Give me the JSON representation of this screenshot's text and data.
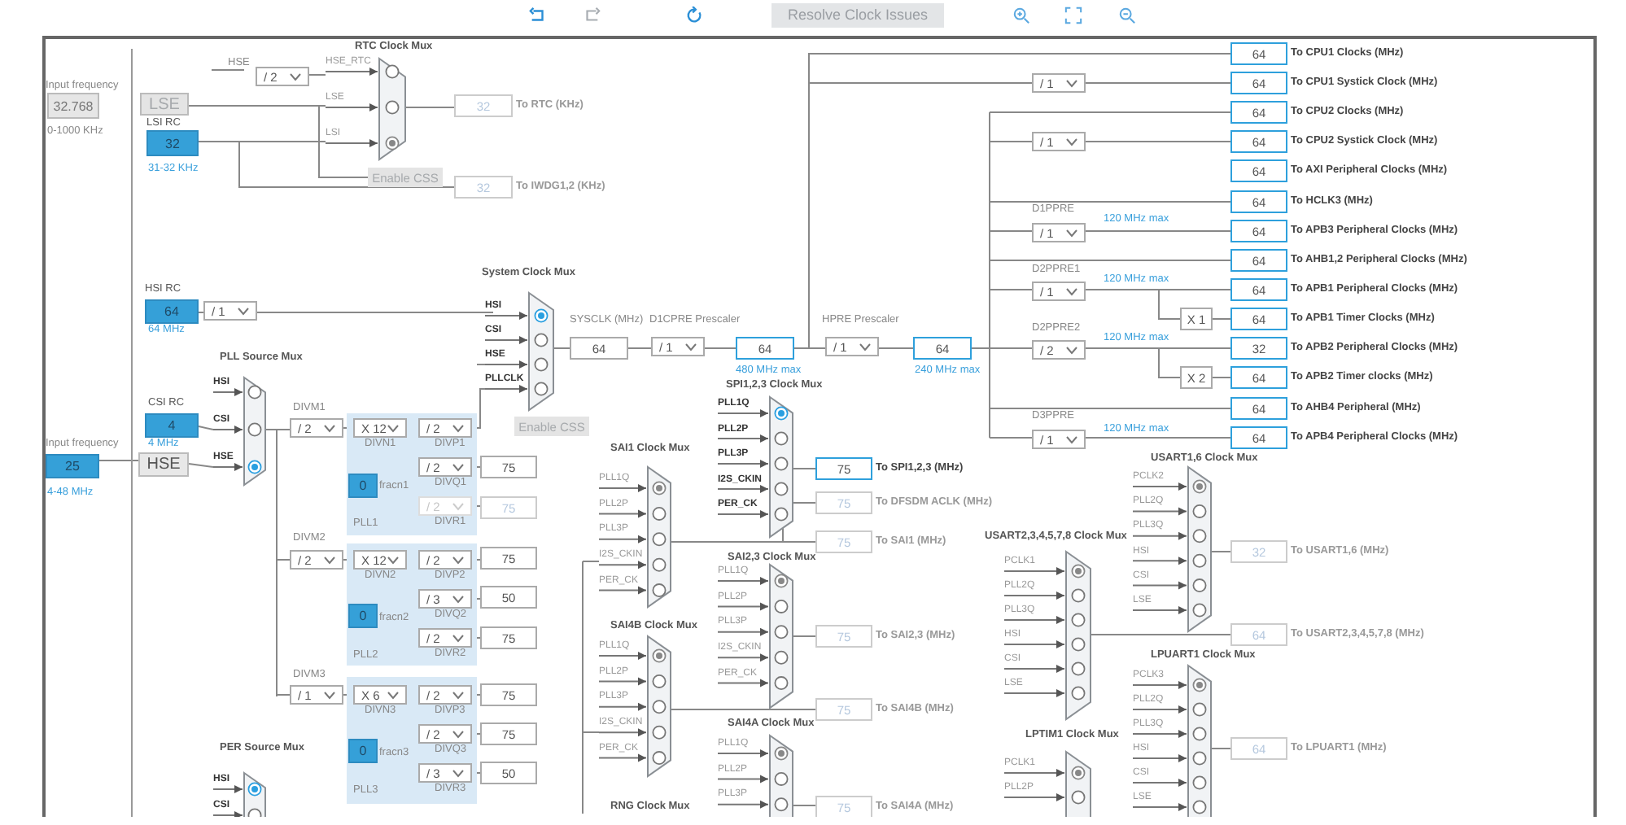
{
  "toolbar": {
    "resolve_button": {
      "label": "Resolve Clock Issues",
      "disabled": true
    }
  },
  "labels": [
    {
      "text": "Input frequency",
      "kind": "caption"
    },
    {
      "text": "0-1000 KHz",
      "kind": "caption"
    },
    {
      "text": "LSI RC",
      "kind": "name"
    },
    {
      "text": "31-32 KHz",
      "kind": "hint"
    },
    {
      "text": "HSE",
      "kind": "caption"
    },
    {
      "text": "HSI RC",
      "kind": "name"
    },
    {
      "text": "64 MHz",
      "kind": "hint"
    },
    {
      "text": "SYSCLK (MHz)",
      "kind": "caption"
    },
    {
      "text": "D1CPRE Prescaler",
      "kind": "caption"
    },
    {
      "text": "480 MHz max",
      "kind": "hint"
    },
    {
      "text": "HPRE Prescaler",
      "kind": "caption"
    },
    {
      "text": "240 MHz max",
      "kind": "hint"
    },
    {
      "text": "D1PPRE",
      "kind": "caption"
    },
    {
      "text": "120 MHz max",
      "kind": "hint"
    },
    {
      "text": "D2PPRE1",
      "kind": "caption"
    },
    {
      "text": "120 MHz max",
      "kind": "hint"
    },
    {
      "text": "D2PPRE2",
      "kind": "caption"
    },
    {
      "text": "120 MHz max",
      "kind": "hint"
    },
    {
      "text": "D3PPRE",
      "kind": "caption"
    },
    {
      "text": "120 MHz max",
      "kind": "hint"
    },
    {
      "text": "CSI RC",
      "kind": "name"
    },
    {
      "text": "Input frequency",
      "kind": "caption"
    },
    {
      "text": "4 MHz",
      "kind": "hint"
    },
    {
      "text": "4-48 MHz",
      "kind": "hint"
    },
    {
      "text": "DIVM1",
      "kind": "caption"
    },
    {
      "text": "DIVN1",
      "kind": "caption"
    },
    {
      "text": "DIVP1",
      "kind": "caption"
    },
    {
      "text": "DIVQ1",
      "kind": "caption"
    },
    {
      "text": "fracn1",
      "kind": "caption"
    },
    {
      "text": "DIVR1",
      "kind": "caption"
    },
    {
      "text": "PLL1",
      "kind": "caption"
    },
    {
      "text": "DIVM2",
      "kind": "caption"
    },
    {
      "text": "DIVN2",
      "kind": "caption"
    },
    {
      "text": "DIVP2",
      "kind": "caption"
    },
    {
      "text": "DIVQ2",
      "kind": "caption"
    },
    {
      "text": "fracn2",
      "kind": "caption"
    },
    {
      "text": "DIVR2",
      "kind": "caption"
    },
    {
      "text": "PLL2",
      "kind": "caption"
    },
    {
      "text": "DIVM3",
      "kind": "caption"
    },
    {
      "text": "DIVN3",
      "kind": "caption"
    },
    {
      "text": "DIVP3",
      "kind": "caption"
    },
    {
      "text": "DIVQ3",
      "kind": "caption"
    },
    {
      "text": "fracn3",
      "kind": "caption"
    },
    {
      "text": "DIVR3",
      "kind": "caption"
    },
    {
      "text": "PLL3",
      "kind": "caption"
    },
    {
      "text": "RNG Clock Mux",
      "kind": "title"
    }
  ],
  "inputs": [
    {
      "value": "32.768",
      "disabled": true
    },
    {
      "value": "32",
      "disabled": false
    },
    {
      "value": "64",
      "disabled": false
    },
    {
      "value": "4",
      "disabled": false
    },
    {
      "value": "25",
      "disabled": false
    },
    {
      "value": "0",
      "disabled": false
    },
    {
      "value": "0",
      "disabled": false
    },
    {
      "value": "0",
      "disabled": false
    }
  ],
  "buttons": [
    {
      "label": "LSE",
      "kind": "oscillator",
      "disabled": true
    },
    {
      "label": "HSE",
      "kind": "oscillator",
      "disabled": false
    },
    {
      "label": "Enable CSS",
      "kind": "css",
      "disabled": true
    },
    {
      "label": "Enable CSS",
      "kind": "css",
      "disabled": true
    }
  ],
  "dropdowns": [
    {
      "value": "/ 2",
      "disabled": false
    },
    {
      "value": "/ 1",
      "disabled": false
    },
    {
      "value": "/ 1",
      "disabled": false
    },
    {
      "value": "/ 1",
      "disabled": false
    },
    {
      "value": "/ 1",
      "disabled": false
    },
    {
      "value": "/ 1",
      "disabled": false
    },
    {
      "value": "/ 1",
      "disabled": false
    },
    {
      "value": "/ 1",
      "disabled": false
    },
    {
      "value": "/ 2",
      "disabled": false
    },
    {
      "value": "/ 1",
      "disabled": false
    },
    {
      "value": "/ 2",
      "disabled": false
    },
    {
      "value": "X 12",
      "disabled": false
    },
    {
      "value": "/ 2",
      "disabled": false
    },
    {
      "value": "/ 2",
      "disabled": false
    },
    {
      "value": "/ 2",
      "disabled": true
    },
    {
      "value": "/ 2",
      "disabled": false
    },
    {
      "value": "X 12",
      "disabled": false
    },
    {
      "value": "/ 2",
      "disabled": false
    },
    {
      "value": "/ 3",
      "disabled": false
    },
    {
      "value": "/ 2",
      "disabled": false
    },
    {
      "value": "/ 1",
      "disabled": false
    },
    {
      "value": "X 6",
      "disabled": false
    },
    {
      "value": "/ 2",
      "disabled": false
    },
    {
      "value": "/ 2",
      "disabled": false
    },
    {
      "value": "/ 3",
      "disabled": false
    }
  ],
  "outputs": [
    {
      "value": "32",
      "label": "To RTC (KHz)",
      "highlighted": false,
      "disabled": true
    },
    {
      "value": "32",
      "label": "To IWDG1,2 (KHz)",
      "highlighted": false,
      "disabled": true
    },
    {
      "value": "64",
      "highlighted": false,
      "disabled": false
    },
    {
      "value": "64",
      "highlighted": true,
      "disabled": false
    },
    {
      "value": "64",
      "highlighted": true,
      "disabled": false
    },
    {
      "value": "64",
      "label": "To CPU1 Clocks (MHz)",
      "highlighted": true,
      "disabled": false
    },
    {
      "value": "64",
      "label": "To CPU1 Systick Clock (MHz)",
      "highlighted": true,
      "disabled": false
    },
    {
      "value": "64",
      "label": "To CPU2 Clocks (MHz)",
      "highlighted": true,
      "disabled": false
    },
    {
      "value": "64",
      "label": "To CPU2 Systick Clock (MHz)",
      "highlighted": true,
      "disabled": false
    },
    {
      "value": "64",
      "label": "To AXI Peripheral Clocks (MHz)",
      "highlighted": true,
      "disabled": false
    },
    {
      "value": "64",
      "label": "To HCLK3 (MHz)",
      "highlighted": true,
      "disabled": false
    },
    {
      "value": "64",
      "label": "To APB3 Peripheral Clocks (MHz)",
      "highlighted": true,
      "disabled": false
    },
    {
      "value": "64",
      "label": "To AHB1,2 Peripheral Clocks (MHz)",
      "highlighted": true,
      "disabled": false
    },
    {
      "value": "64",
      "label": "To APB1 Peripheral Clocks (MHz)",
      "highlighted": true,
      "disabled": false
    },
    {
      "value": "64",
      "label": "To APB1 Timer Clocks (MHz)",
      "highlighted": true,
      "disabled": false
    },
    {
      "value": "32",
      "label": "To APB2 Peripheral Clocks (MHz)",
      "highlighted": true,
      "disabled": false
    },
    {
      "value": "64",
      "label": "To APB2 Timer clocks (MHz)",
      "highlighted": true,
      "disabled": false
    },
    {
      "value": "64",
      "label": "To AHB4 Peripheral (MHz)",
      "highlighted": true,
      "disabled": false
    },
    {
      "value": "64",
      "label": "To APB4 Peripheral Clocks (MHz)",
      "highlighted": true,
      "disabled": false
    },
    {
      "value": "X 1",
      "highlighted": false,
      "disabled": false
    },
    {
      "value": "X 2",
      "highlighted": false,
      "disabled": false
    },
    {
      "value": "75",
      "highlighted": false,
      "disabled": false
    },
    {
      "value": "75",
      "highlighted": false,
      "disabled": true
    },
    {
      "value": "75",
      "highlighted": false,
      "disabled": false
    },
    {
      "value": "50",
      "highlighted": false,
      "disabled": false
    },
    {
      "value": "75",
      "highlighted": false,
      "disabled": false
    },
    {
      "value": "75",
      "highlighted": false,
      "disabled": false
    },
    {
      "value": "75",
      "highlighted": false,
      "disabled": false
    },
    {
      "value": "50",
      "highlighted": false,
      "disabled": false
    },
    {
      "value": "75",
      "label": "To SPI1,2,3 (MHz)",
      "highlighted": true,
      "disabled": false
    },
    {
      "value": "75",
      "label": "To DFSDM ACLK (MHz)",
      "highlighted": false,
      "disabled": true
    },
    {
      "value": "75",
      "label": "To SAI1 (MHz)",
      "highlighted": false,
      "disabled": true
    },
    {
      "value": "75",
      "label": "To SAI2,3 (MHz)",
      "highlighted": false,
      "disabled": true
    },
    {
      "value": "75",
      "label": "To SAI4B (MHz)",
      "highlighted": false,
      "disabled": true
    },
    {
      "value": "75",
      "label": "To SAI4A (MHz)",
      "highlighted": false,
      "disabled": true
    },
    {
      "value": "32",
      "label": "To USART1,6 (MHz)",
      "highlighted": false,
      "disabled": true
    },
    {
      "value": "64",
      "label": "To USART2,3,4,5,7,8 (MHz)",
      "highlighted": false,
      "disabled": true
    },
    {
      "value": "64",
      "label": "To LPUART1 (MHz)",
      "highlighted": false,
      "disabled": true
    }
  ],
  "muxes": [
    {
      "title": "RTC Clock Mux",
      "active": false,
      "inputs": [
        {
          "label": "HSE_RTC",
          "selected": false
        },
        {
          "label": "LSE",
          "selected": false
        },
        {
          "label": "LSI",
          "selected": true
        }
      ]
    },
    {
      "title": "System Clock Mux",
      "active": true,
      "inputs": [
        {
          "label": "HSI",
          "selected": true
        },
        {
          "label": "CSI",
          "selected": false
        },
        {
          "label": "HSE",
          "selected": false
        },
        {
          "label": "PLLCLK",
          "selected": false
        }
      ]
    },
    {
      "title": "PLL Source Mux",
      "active": true,
      "inputs": [
        {
          "label": "HSI",
          "selected": false
        },
        {
          "label": "CSI",
          "selected": false
        },
        {
          "label": "HSE",
          "selected": true
        }
      ]
    },
    {
      "title": "SPI1,2,3 Clock Mux",
      "active": true,
      "inputs": [
        {
          "label": "PLL1Q",
          "selected": true
        },
        {
          "label": "PLL2P",
          "selected": false
        },
        {
          "label": "PLL3P",
          "selected": false
        },
        {
          "label": "I2S_CKIN",
          "selected": false
        },
        {
          "label": "PER_CK",
          "selected": false
        }
      ]
    },
    {
      "title": "SAI1 Clock Mux",
      "active": false,
      "inputs": [
        {
          "label": "PLL1Q",
          "selected": true
        },
        {
          "label": "PLL2P",
          "selected": false
        },
        {
          "label": "PLL3P",
          "selected": false
        },
        {
          "label": "I2S_CKIN",
          "selected": false
        },
        {
          "label": "PER_CK",
          "selected": false
        }
      ]
    },
    {
      "title": "SAI2,3 Clock Mux",
      "active": false,
      "inputs": [
        {
          "label": "PLL1Q",
          "selected": true
        },
        {
          "label": "PLL2P",
          "selected": false
        },
        {
          "label": "PLL3P",
          "selected": false
        },
        {
          "label": "I2S_CKIN",
          "selected": false
        },
        {
          "label": "PER_CK",
          "selected": false
        }
      ]
    },
    {
      "title": "SAI4B Clock Mux",
      "active": false,
      "inputs": [
        {
          "label": "PLL1Q",
          "selected": true
        },
        {
          "label": "PLL2P",
          "selected": false
        },
        {
          "label": "PLL3P",
          "selected": false
        },
        {
          "label": "I2S_CKIN",
          "selected": false
        },
        {
          "label": "PER_CK",
          "selected": false
        }
      ]
    },
    {
      "title": "SAI4A Clock Mux",
      "active": false,
      "inputs": [
        {
          "label": "PLL1Q",
          "selected": true
        },
        {
          "label": "PLL2P",
          "selected": false
        },
        {
          "label": "PLL3P",
          "selected": false
        }
      ]
    },
    {
      "title": "PER Source Mux",
      "active": true,
      "inputs": [
        {
          "label": "HSI",
          "selected": true
        },
        {
          "label": "CSI",
          "selected": false
        }
      ]
    },
    {
      "title": "USART1,6 Clock Mux",
      "active": false,
      "inputs": [
        {
          "label": "PCLK2",
          "selected": true
        },
        {
          "label": "PLL2Q",
          "selected": false
        },
        {
          "label": "PLL3Q",
          "selected": false
        },
        {
          "label": "HSI",
          "selected": false
        },
        {
          "label": "CSI",
          "selected": false
        },
        {
          "label": "LSE",
          "selected": false
        }
      ]
    },
    {
      "title": "USART2,3,4,5,7,8 Clock Mux",
      "active": false,
      "inputs": [
        {
          "label": "PCLK1",
          "selected": true
        },
        {
          "label": "PLL2Q",
          "selected": false
        },
        {
          "label": "PLL3Q",
          "selected": false
        },
        {
          "label": "HSI",
          "selected": false
        },
        {
          "label": "CSI",
          "selected": false
        },
        {
          "label": "LSE",
          "selected": false
        }
      ]
    },
    {
      "title": "LPUART1 Clock Mux",
      "active": false,
      "inputs": [
        {
          "label": "PCLK3",
          "selected": true
        },
        {
          "label": "PLL2Q",
          "selected": false
        },
        {
          "label": "PLL3Q",
          "selected": false
        },
        {
          "label": "HSI",
          "selected": false
        },
        {
          "label": "CSI",
          "selected": false
        },
        {
          "label": "LSE",
          "selected": false
        }
      ]
    },
    {
      "title": "LPTIM1 Clock Mux",
      "active": false,
      "inputs": [
        {
          "label": "PCLK1",
          "selected": true
        },
        {
          "label": "PLL2P",
          "selected": false
        }
      ]
    }
  ]
}
